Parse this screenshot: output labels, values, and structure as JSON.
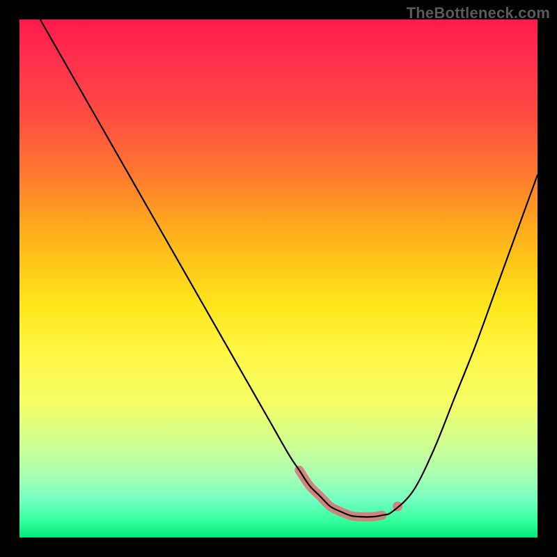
{
  "watermark": "TheBottleneck.com",
  "colors": {
    "curve": "#000000",
    "highlight": "#d97a7a",
    "gradient_top": "#ff1a4d",
    "gradient_bottom": "#00e87a",
    "frame": "#000000"
  },
  "chart_data": {
    "type": "line",
    "title": "",
    "xlabel": "",
    "ylabel": "",
    "xlim": [
      0,
      100
    ],
    "ylim": [
      0,
      100
    ],
    "grid": false,
    "legend": false,
    "series": [
      {
        "name": "bottleneck",
        "x": [
          4,
          8,
          12,
          16,
          20,
          24,
          28,
          32,
          36,
          40,
          44,
          48,
          52,
          54,
          56,
          58,
          60,
          62,
          64,
          66,
          68,
          70,
          72,
          76,
          80,
          84,
          88,
          92,
          96,
          100
        ],
        "y": [
          100,
          93,
          86,
          79,
          72,
          65,
          58,
          51,
          44,
          37,
          30,
          23,
          16,
          13,
          10,
          8,
          6,
          5,
          4.2,
          4,
          4,
          4.3,
          5,
          9,
          17,
          27,
          37,
          48,
          59,
          70
        ]
      }
    ],
    "highlight_range": {
      "name": "optimal_zone",
      "x": [
        54,
        56,
        58,
        60,
        62,
        64,
        66,
        68,
        70
      ],
      "y": [
        13,
        10,
        8,
        6,
        5,
        4.2,
        4,
        4,
        4.3
      ],
      "marker_x": 73,
      "marker_y": 6
    }
  }
}
